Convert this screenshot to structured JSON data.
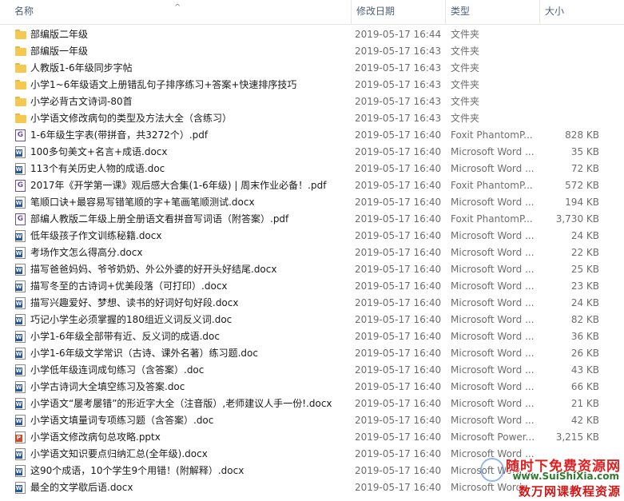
{
  "columns": {
    "name": "名称",
    "date": "修改日期",
    "type": "类型",
    "size": "大小"
  },
  "files": [
    {
      "icon": "folder",
      "name": "部编版二年级",
      "date": "2019-05-17 16:44",
      "type": "文件夹",
      "size": ""
    },
    {
      "icon": "folder",
      "name": "部编版一年级",
      "date": "2019-05-17 16:43",
      "type": "文件夹",
      "size": ""
    },
    {
      "icon": "folder",
      "name": "人教版1-6年级同步字帖",
      "date": "2019-05-17 16:43",
      "type": "文件夹",
      "size": ""
    },
    {
      "icon": "folder",
      "name": "小学1~6年级语文上册错乱句子排序练习+答案+快速排序技巧",
      "date": "2019-05-17 16:43",
      "type": "文件夹",
      "size": ""
    },
    {
      "icon": "folder",
      "name": "小学必背古文诗词-80首",
      "date": "2019-05-17 16:43",
      "type": "文件夹",
      "size": ""
    },
    {
      "icon": "folder",
      "name": "小学语文修改病句的类型及方法大全（含练习）",
      "date": "2019-05-17 16:43",
      "type": "文件夹",
      "size": ""
    },
    {
      "icon": "pdf",
      "name": "1-6年级生字表(带拼音，共3272个）.pdf",
      "date": "2019-05-17 16:40",
      "type": "Foxit PhantomP...",
      "size": "828 KB"
    },
    {
      "icon": "doc",
      "name": "100多句美文+名言+成语.docx",
      "date": "2019-05-17 16:40",
      "type": "Microsoft Word ...",
      "size": "35 KB"
    },
    {
      "icon": "doc",
      "name": "113个有关历史人物的成语.doc",
      "date": "2019-05-17 16:40",
      "type": "Microsoft Word ...",
      "size": "72 KB"
    },
    {
      "icon": "pdf",
      "name": "2017年《开学第一课》观后感大合集(1-6年级) | 周末作业必备！.pdf",
      "date": "2019-05-17 16:40",
      "type": "Foxit PhantomP...",
      "size": "572 KB"
    },
    {
      "icon": "doc",
      "name": "笔顺口诀+最容易写错笔顺的字+笔画笔顺测试.docx",
      "date": "2019-05-17 16:40",
      "type": "Microsoft Word ...",
      "size": "194 KB"
    },
    {
      "icon": "pdf",
      "name": "部编人教版二年级上册全册语文看拼音写词语（附答案）.pdf",
      "date": "2019-05-17 16:40",
      "type": "Foxit PhantomP...",
      "size": "3,730 KB"
    },
    {
      "icon": "doc",
      "name": "低年级孩子作文训练秘籍.docx",
      "date": "2019-05-17 16:40",
      "type": "Microsoft Word ...",
      "size": "24 KB"
    },
    {
      "icon": "doc",
      "name": "考场作文怎么得高分.docx",
      "date": "2019-05-17 16:40",
      "type": "Microsoft Word ...",
      "size": "22 KB"
    },
    {
      "icon": "doc",
      "name": "描写爸爸妈妈、爷爷奶奶、外公外婆的好开头好结尾.docx",
      "date": "2019-05-17 16:40",
      "type": "Microsoft Word ...",
      "size": "25 KB"
    },
    {
      "icon": "doc",
      "name": "描写冬至的古诗词+优美段落（可打印）.docx",
      "date": "2019-05-17 16:40",
      "type": "Microsoft Word ...",
      "size": "23 KB"
    },
    {
      "icon": "doc",
      "name": "描写兴趣爱好、梦想、读书的好词好句好段.docx",
      "date": "2019-05-17 16:40",
      "type": "Microsoft Word ...",
      "size": "24 KB"
    },
    {
      "icon": "doc",
      "name": "巧记小学生必须掌握的180组近义词反义词.doc",
      "date": "2019-05-17 16:40",
      "type": "Microsoft Word ...",
      "size": "82 KB"
    },
    {
      "icon": "doc",
      "name": "小学1-6年级全部带有近、反义词的成语.doc",
      "date": "2019-05-17 16:40",
      "type": "Microsoft Word ...",
      "size": "36 KB"
    },
    {
      "icon": "doc",
      "name": "小学1-6年级文学常识（古诗、课外名著）练习题.doc",
      "date": "2019-05-17 16:40",
      "type": "Microsoft Word ...",
      "size": "26 KB"
    },
    {
      "icon": "doc",
      "name": "小学低年级连词成句练习（含答案）.doc",
      "date": "2019-05-17 16:40",
      "type": "Microsoft Word ...",
      "size": "43 KB"
    },
    {
      "icon": "doc",
      "name": "小学古诗词大全填空练习及答案.doc",
      "date": "2019-05-17 16:40",
      "type": "Microsoft Word ...",
      "size": "66 KB"
    },
    {
      "icon": "doc",
      "name": "小学语文“屡考屡错”的形近字大全（注音版）,老师建议人手一份!.docx",
      "date": "2019-05-17 16:40",
      "type": "Microsoft Word ...",
      "size": "21 KB"
    },
    {
      "icon": "doc",
      "name": "小学语文填量词专项练习题（含答案）.doc",
      "date": "2019-05-17 16:40",
      "type": "Microsoft Word ...",
      "size": "42 KB"
    },
    {
      "icon": "ppt",
      "name": "小学语文修改病句总攻略.pptx",
      "date": "2019-05-17 16:40",
      "type": "Microsoft Power...",
      "size": "3,215 KB"
    },
    {
      "icon": "doc",
      "name": "小学语文知识要点归纳汇总(全年级).docx",
      "date": "2019-05-17 16:40",
      "type": "Microsoft Word ...",
      "size": ""
    },
    {
      "icon": "doc",
      "name": "这90个成语，10个学生9个用错！(附解释）.docx",
      "date": "2019-05-17 16:40",
      "type": "Microsoft Word ...",
      "size": ""
    },
    {
      "icon": "doc",
      "name": "最全的文学歇后语.docx",
      "date": "2019-05-17 16:40",
      "type": "Microsoft Word ...",
      "size": ""
    }
  ],
  "icon_names": {
    "folder": "folder-icon",
    "doc": "word-document-icon",
    "pdf": "pdf-document-icon",
    "ppt": "powerpoint-document-icon"
  },
  "watermark": {
    "line1": "随时下免费资源网",
    "line2": "www.SuiShiXia.com",
    "line3": "数万网课教程资源"
  },
  "colors": {
    "header_text": "#4c607a",
    "folder": "#f5c94f",
    "word": "#2b5797",
    "powerpoint": "#d24726",
    "pdf": "#6b4f9e",
    "watermark_red": "#e02020"
  }
}
